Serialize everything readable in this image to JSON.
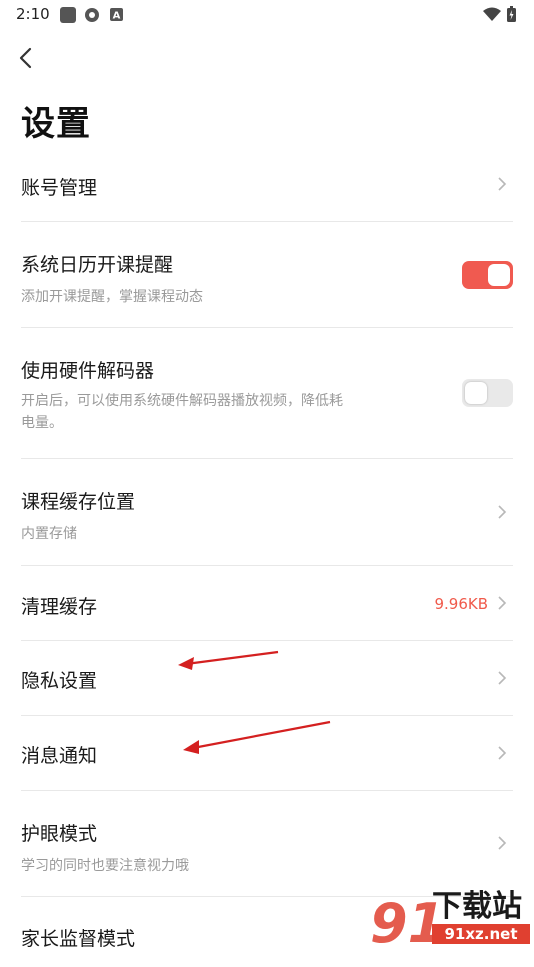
{
  "status_bar": {
    "time": "2:10"
  },
  "page": {
    "title": "设置"
  },
  "settings": {
    "account": {
      "title": "账号管理"
    },
    "calendar": {
      "title": "系统日历开课提醒",
      "subtitle": "添加开课提醒，掌握课程动态",
      "enabled": true
    },
    "hw_decoder": {
      "title": "使用硬件解码器",
      "subtitle_line1": "开启后，可以使用系统硬件解码器播放视频，降低耗",
      "subtitle_line2": "电量。",
      "enabled": false
    },
    "cache_location": {
      "title": "课程缓存位置",
      "subtitle": "内置存储"
    },
    "clear_cache": {
      "title": "清理缓存",
      "value": "9.96KB"
    },
    "privacy": {
      "title": "隐私设置"
    },
    "notifications": {
      "title": "消息通知"
    },
    "eye_care": {
      "title": "护眼模式",
      "subtitle": "学习的同时也要注意视力哦"
    },
    "parental": {
      "title": "家长监督模式"
    }
  },
  "watermark": {
    "brand": "下载站",
    "domain": "91xz.net",
    "numeral": "91"
  },
  "colors": {
    "accent": "#f05a50",
    "value_text": "#f05a4b",
    "divider": "#e8e8e8",
    "subtitle": "#9a9a9a"
  }
}
